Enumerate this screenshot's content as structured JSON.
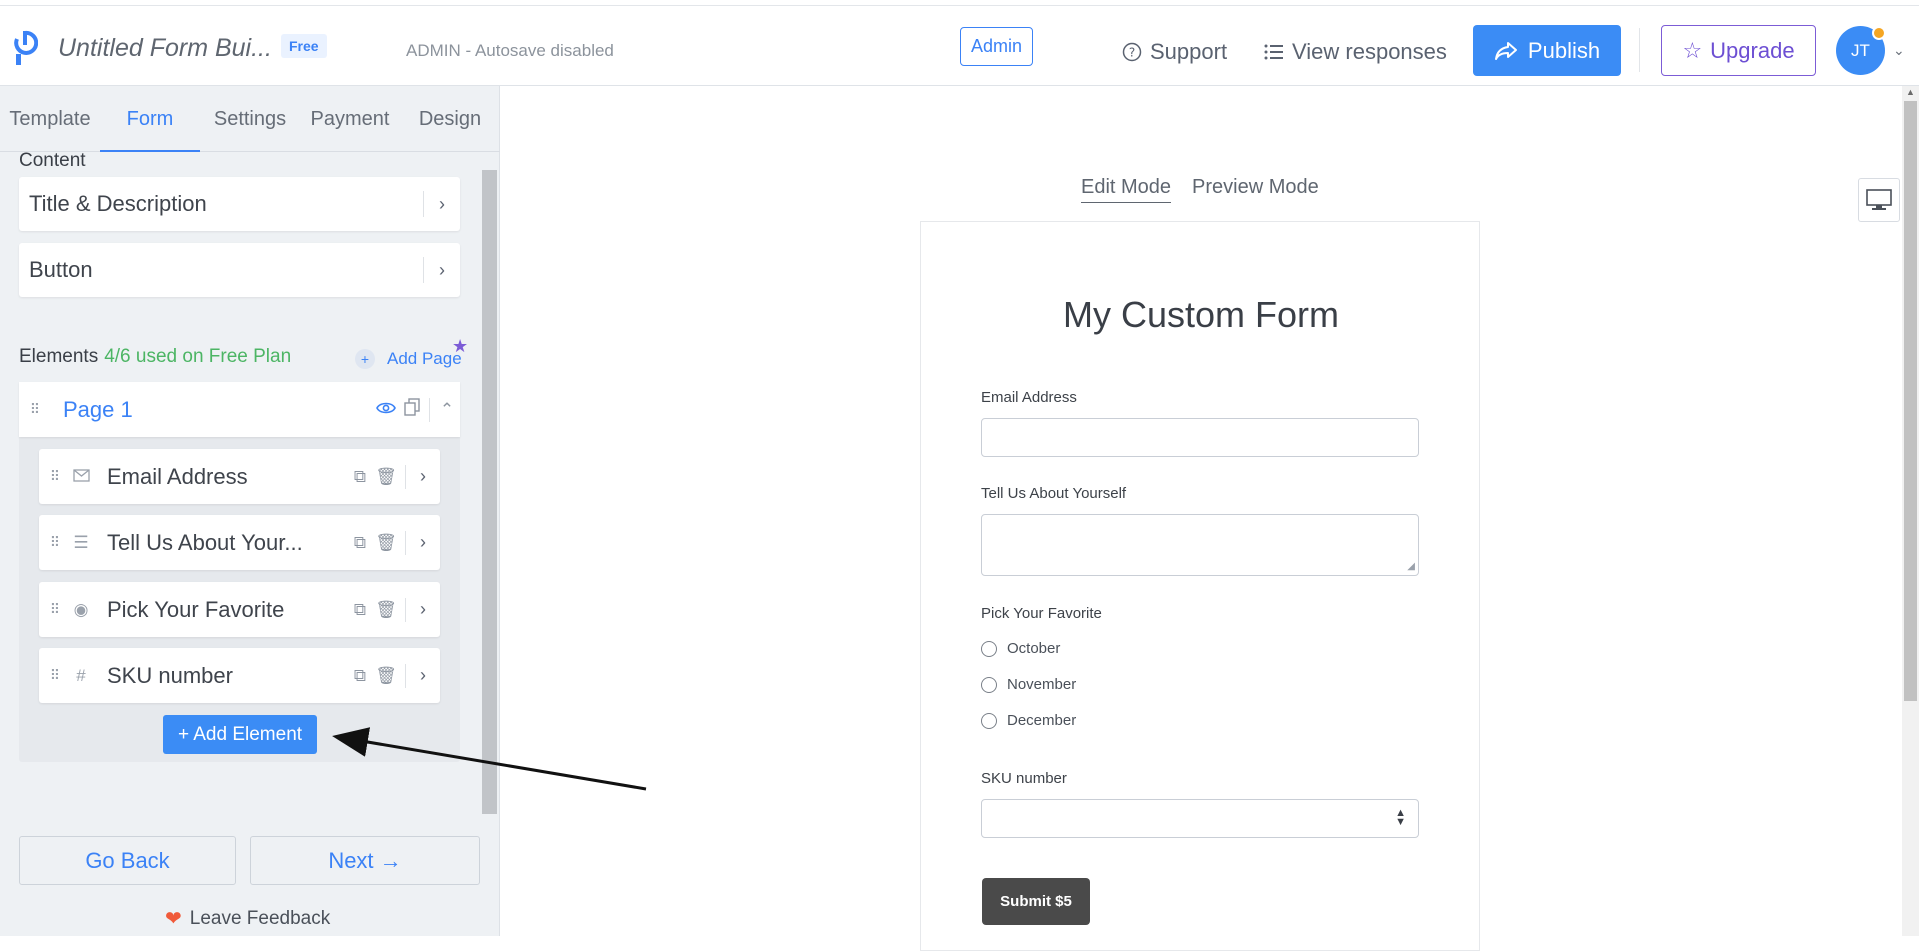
{
  "header": {
    "form_title": "Untitled Form Bui...",
    "plan_badge": "Free",
    "admin_status": "ADMIN - Autosave disabled",
    "admin_button": "Admin",
    "support": "Support",
    "view_responses": "View responses",
    "publish": "Publish",
    "upgrade": "Upgrade",
    "avatar_initials": "JT"
  },
  "sidebar": {
    "tabs": [
      "Template",
      "Form",
      "Settings",
      "Payment",
      "Design"
    ],
    "active_tab": "Form",
    "content_label": "Content",
    "content_cards": [
      "Title & Description",
      "Button"
    ],
    "elements_label": "Elements",
    "elements_count": "4/6 used on Free Plan",
    "add_page": "Add Page",
    "page_title": "Page 1",
    "elements": [
      {
        "label": "Email Address",
        "icon": "envelope-icon"
      },
      {
        "label": "Tell Us About Your...",
        "icon": "paragraph-lines-icon"
      },
      {
        "label": "Pick Your Favorite",
        "icon": "radio-dot-icon"
      },
      {
        "label": "SKU number",
        "icon": "hash-icon"
      }
    ],
    "add_element": "+ Add Element",
    "go_back": "Go Back",
    "next": "Next →",
    "feedback": "Leave Feedback"
  },
  "canvas": {
    "edit_mode": "Edit Mode",
    "preview_mode": "Preview Mode",
    "form": {
      "heading": "My Custom Form",
      "email_label": "Email Address",
      "about_label": "Tell Us About Yourself",
      "favorite_label": "Pick Your Favorite",
      "options": [
        "October",
        "November",
        "December"
      ],
      "sku_label": "SKU number",
      "submit": "Submit $5"
    }
  },
  "colors": {
    "accent": "#3b8cf5",
    "upgrade": "#6d4fd3",
    "success_text": "#4cb564",
    "submit_bg": "#4a4a4a"
  }
}
